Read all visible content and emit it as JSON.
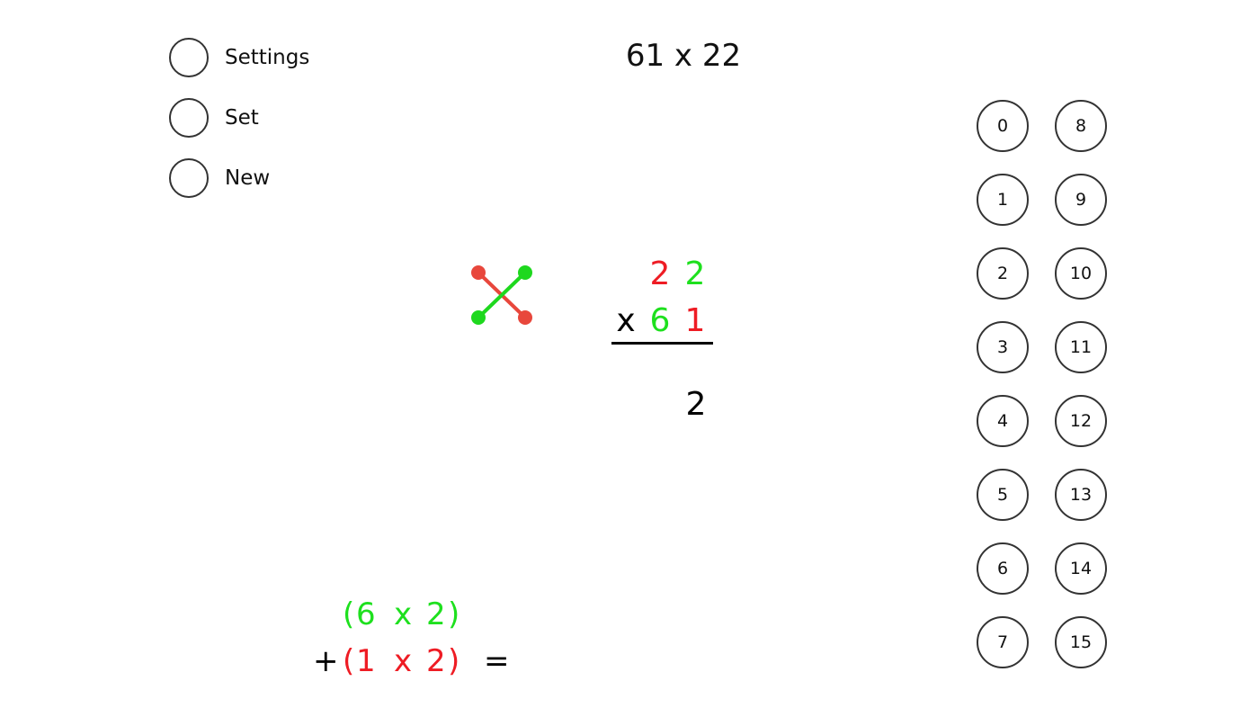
{
  "colors": {
    "green": "#1ee01e",
    "red": "#ee1c24",
    "cross_red": "#e8473c",
    "cross_green": "#1ed81e"
  },
  "menu": [
    {
      "label": "Settings",
      "icon": "radio-circle-icon"
    },
    {
      "label": "Set",
      "icon": "radio-circle-icon"
    },
    {
      "label": "New",
      "icon": "radio-circle-icon"
    }
  ],
  "problem": "61 x 22",
  "cross_icon": "cross-multiply-icon",
  "multiplication": {
    "top": [
      "2",
      "2"
    ],
    "operator": "x",
    "bottom": [
      "6",
      "1"
    ],
    "answer": "2"
  },
  "equation": {
    "line1": {
      "open": "(",
      "a": "6",
      "op": "x",
      "b": "2",
      "close": ")"
    },
    "plus": "+",
    "line2": {
      "open": "(",
      "a": "1",
      "op": "x",
      "b": "2",
      "close": ")"
    },
    "equals": "="
  },
  "number_buttons": [
    "0",
    "1",
    "2",
    "3",
    "4",
    "5",
    "6",
    "7",
    "8",
    "9",
    "10",
    "11",
    "12",
    "13",
    "14",
    "15"
  ]
}
